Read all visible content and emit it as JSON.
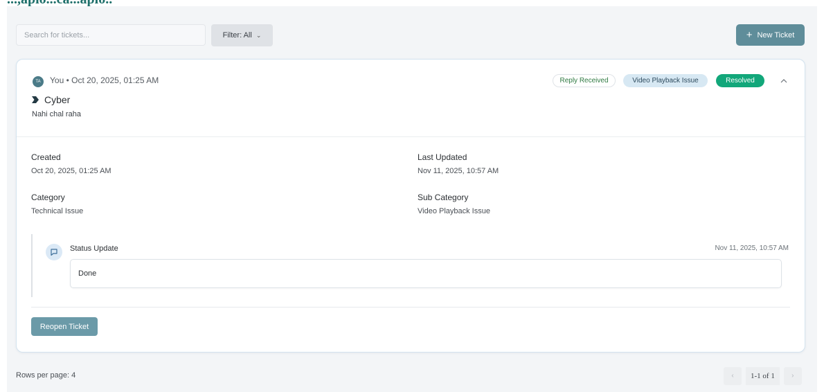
{
  "header_fragment": "...,aplo...ca...aplo..",
  "toolbar": {
    "search_placeholder": "Search for tickets...",
    "filter_label": "Filter: All",
    "filter_icon": "chevron-down-icon",
    "new_ticket_label": "New Ticket",
    "new_ticket_icon": "plus-icon"
  },
  "ticket": {
    "avatar_initials": "TA",
    "meta": "You • Oct 20, 2025, 01:25 AM",
    "title": "Cyber",
    "title_icon": "chevron-tag-icon",
    "description": "Nahi chal raha",
    "badges": {
      "reply": "Reply Received",
      "subcategory": "Video Playback Issue",
      "status": "Resolved"
    },
    "collapse_icon": "chevron-up-icon",
    "details": {
      "created_label": "Created",
      "created_value": "Oct 20, 2025, 01:25 AM",
      "updated_label": "Last Updated",
      "updated_value": "Nov 11, 2025, 10:57 AM",
      "category_label": "Category",
      "category_value": "Technical Issue",
      "subcategory_label": "Sub Category",
      "subcategory_value": "Video Playback Issue"
    },
    "history": [
      {
        "icon": "message-icon",
        "title": "Status Update",
        "time": "Nov 11, 2025, 10:57 AM",
        "body": "Done"
      }
    ],
    "reopen_label": "Reopen Ticket"
  },
  "footer": {
    "rows_per_page": "Rows per page: 4",
    "page_range": "1-1 of 1",
    "prev_icon": "chevron-left-icon",
    "next_icon": "chevron-right-icon"
  },
  "colors": {
    "primary": "#5f8d9a",
    "resolved": "#12a77a",
    "subcategory_badge": "#d7e8f3",
    "page_bg": "#f3f5f7"
  }
}
